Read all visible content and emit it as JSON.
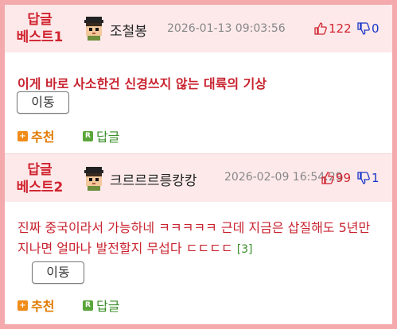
{
  "colors": {
    "frame": "#f4a9ad",
    "header_bg": "#fde9ea",
    "accent_red": "#d0232f",
    "like_red": "#d0232f",
    "dislike_blue": "#1a36c8",
    "reply_green": "#3b8f2a",
    "recommend_orange": "#e07a00"
  },
  "posts": [
    {
      "badge_line1": "답글",
      "badge_line2": "베스트1",
      "nickname": "조철봉",
      "timestamp": "2026-01-13 09:03:56",
      "likes": "122",
      "dislikes": "0",
      "title": "이게 바로 사소한건 신경쓰지 않는 대륙의 기상",
      "move_label": "이동",
      "recommend_label": "추천",
      "reply_label": "답글",
      "recommend_icon": "plus-icon",
      "reply_icon": "r-icon"
    },
    {
      "badge_line1": "답글",
      "badge_line2": "베스트2",
      "nickname": "크르르르릉캉캉",
      "timestamp": "2026-02-09 16:54:29",
      "likes": "99",
      "dislikes": "1",
      "body": "진짜 중국이라서 가능하네 ㅋㅋㅋㅋㅋ 근데 지금은 삽질해도 5년만 지나면 얼마나 발전할지 무섭다 ㄷㄷㄷㄷ",
      "reply_count": "[3]",
      "move_label": "이동",
      "recommend_label": "추천",
      "reply_label": "답글",
      "recommend_icon": "plus-icon",
      "reply_icon": "r-icon"
    }
  ]
}
